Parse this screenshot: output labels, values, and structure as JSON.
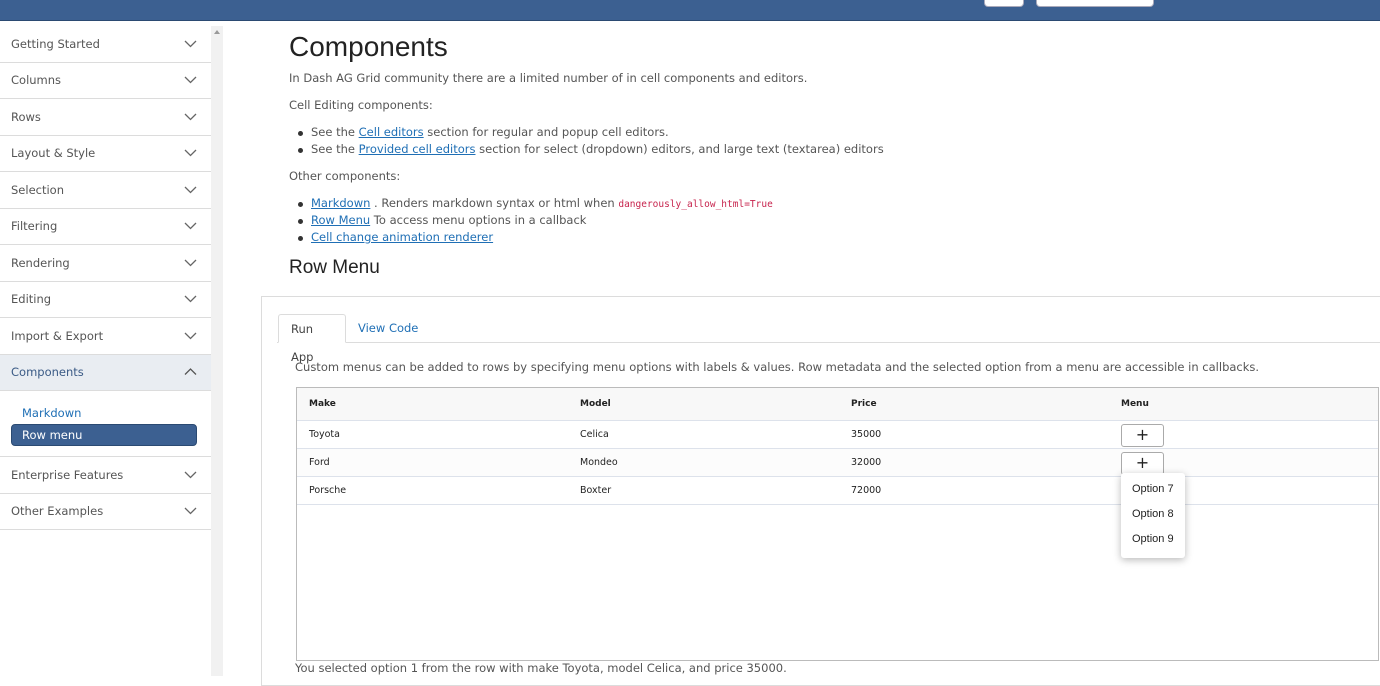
{
  "sidebar": {
    "items": [
      {
        "label": "Getting Started",
        "expanded": false
      },
      {
        "label": "Columns",
        "expanded": false
      },
      {
        "label": "Rows",
        "expanded": false
      },
      {
        "label": "Layout & Style",
        "expanded": false
      },
      {
        "label": "Selection",
        "expanded": false
      },
      {
        "label": "Filtering",
        "expanded": false
      },
      {
        "label": "Rendering",
        "expanded": false
      },
      {
        "label": "Editing",
        "expanded": false
      },
      {
        "label": "Import & Export",
        "expanded": false
      },
      {
        "label": "Components",
        "expanded": true
      },
      {
        "label": "Enterprise Features",
        "expanded": false
      },
      {
        "label": "Other Examples",
        "expanded": false
      }
    ],
    "sub_items": [
      "Markdown",
      "Row menu"
    ],
    "active_sub": "Row menu"
  },
  "main": {
    "title": "Components",
    "intro": "In Dash AG Grid community there are a limited number of in cell components and editors.",
    "cell_editing_heading": "Cell Editing components:",
    "cell_editing_items": [
      {
        "prefix": "See the ",
        "link": "Cell editors",
        "suffix": " section for regular and popup cell editors."
      },
      {
        "prefix": "See the ",
        "link": "Provided cell editors",
        "suffix": " section for select (dropdown) editors, and large text (textarea) editors"
      }
    ],
    "other_heading": "Other components:",
    "other_items": [
      {
        "link": "Markdown",
        "suffix": " . Renders markdown syntax or html when ",
        "code": "dangerously_allow_html=True"
      },
      {
        "link": "Row Menu",
        "suffix": " To access menu options in a callback"
      },
      {
        "link": "Cell change animation renderer",
        "suffix": ""
      }
    ],
    "section_title": "Row Menu"
  },
  "app": {
    "tabs": [
      "Run App",
      "View Code"
    ],
    "active_tab": "Run App",
    "description": "Custom menus can be added to rows by specifying menu options with labels & values. Row metadata and the selected option from a menu are accessible in callbacks.",
    "grid": {
      "columns": [
        "Make",
        "Model",
        "Price",
        "Menu"
      ],
      "rows": [
        {
          "make": "Toyota",
          "model": "Celica",
          "price": "35000"
        },
        {
          "make": "Ford",
          "model": "Mondeo",
          "price": "32000"
        },
        {
          "make": "Porsche",
          "model": "Boxter",
          "price": "72000"
        }
      ],
      "menu_button": "+"
    },
    "popup_options": [
      "Option 7",
      "Option 8",
      "Option 9"
    ],
    "result": "You selected option 1 from the row with make Toyota, model Celica, and price 35000."
  }
}
